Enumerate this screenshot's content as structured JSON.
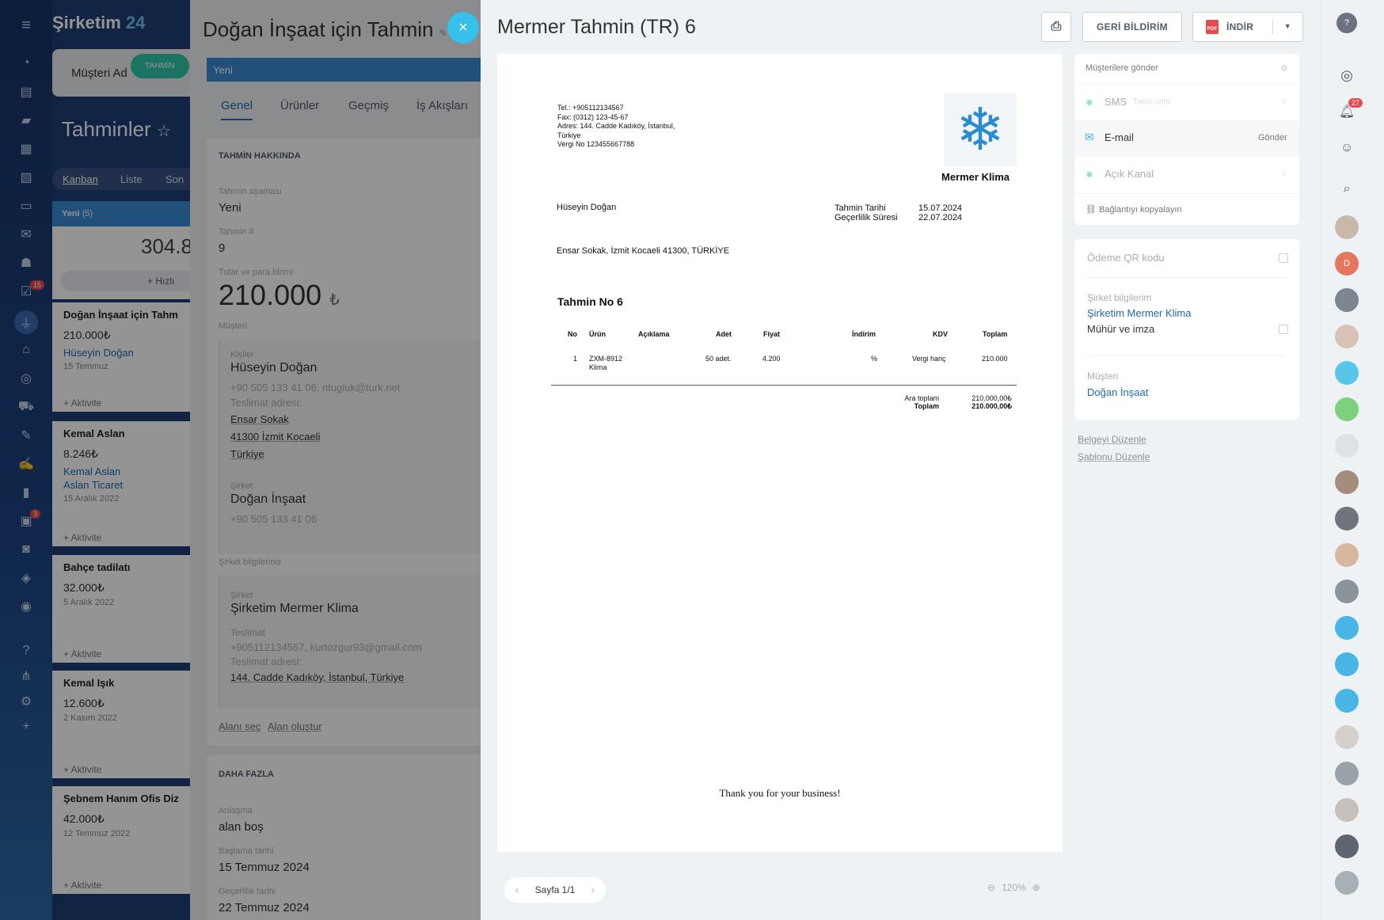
{
  "app": {
    "name": "Şirketim",
    "name_num": "24"
  },
  "rail_badges": {
    "tasks": "15",
    "calendar": "3"
  },
  "crm": {
    "tab_customer": "Müşteri Ad",
    "tab_estimate": "TAHMİN",
    "title": "Tahminler",
    "views": [
      "Kanban",
      "Liste",
      "Son"
    ],
    "column": {
      "label": "Yeni",
      "count": "(5)",
      "total": "304.8",
      "quick": "Hızlı"
    },
    "cards": [
      {
        "title": "Doğan İnşaat için Tahmin",
        "amount": "210.000₺",
        "link1": "Hüseyin Doğan",
        "link2": "",
        "date": "15 Temmuz",
        "action": "+ Aktivite"
      },
      {
        "title": "Kemal Aslan",
        "amount": "8.246₺",
        "link1": "Kemal Aslan",
        "link2": "Aslan Ticaret",
        "date": "15 Aralık 2022",
        "action": "+ Aktivite"
      },
      {
        "title": "Bahçe tadilatı",
        "amount": "32.000₺",
        "link1": "",
        "link2": "",
        "date": "5 Aralık 2022",
        "action": "+ Aktivite"
      },
      {
        "title": "Kemal Işık",
        "amount": "12.600₺",
        "link1": "",
        "link2": "",
        "date": "2 Kasım 2022",
        "action": "+ Aktivite"
      },
      {
        "title": "Şebnem Hanım Ofis Dizayn",
        "amount": "42.000₺",
        "link1": "",
        "link2": "",
        "date": "12 Temmuz 2022",
        "action": "+ Aktivite"
      }
    ]
  },
  "estimate": {
    "title": "Doğan İnşaat için Tahmin",
    "stage_bar": "Yeni",
    "tabs": [
      "Genel",
      "Ürünler",
      "Geçmiş",
      "İş Akışları"
    ],
    "about_header": "TAHMİN HAKKINDA",
    "stage_label": "Tahmin aşaması",
    "stage_value": "Yeni",
    "num_label": "Tahmin #",
    "num_value": "9",
    "amount_label": "Tutar ve para birimi",
    "amount_value": "210.000",
    "currency": "₺",
    "customer_label": "Müşteri",
    "contacts_label": "Kişiler",
    "contact_name": "Hüseyin Doğan",
    "contact_info": "+90 505 133 41 06, ntugluk@turk.net",
    "delivery_label": "Teslimat adresi:",
    "addr1": "Ensar Sokak",
    "addr2": "41300 İzmit Kocaeli",
    "addr3": "Türkiye",
    "company_label": "Şirket",
    "company_name": "Doğan İnşaat",
    "company_phone": "+90 505 133 41 06",
    "yourco_label": "Şirket bilgileriniz",
    "yourco_company_label": "Şirket",
    "yourco_company": "Şirketim Mermer Klima",
    "yourco_delivery_label": "Teslimat",
    "yourco_delivery": "+905112134567, kurtozgur93@gmail.com",
    "yourco_addr_label": "Teslimat adresi:",
    "yourco_addr": "144. Cadde Kadıköy, İstanbul, Türkiye",
    "select_field": "Alanı seç",
    "create_field": "Alan oluştur",
    "more_header": "DAHA FAZLA",
    "deal_label": "Anlaşma",
    "deal_value": "alan boş",
    "start_label": "Başlama tarihi",
    "start_value": "15 Temmuz 2024",
    "valid_label": "Geçerlilik tarihi",
    "valid_value": "22 Temmuz 2024"
  },
  "doc_view": {
    "title": "Mermer Tahmin (TR) 6",
    "feedback": "GERİ BİLDİRİM",
    "download": "İNDİR",
    "page": "Sayfa 1/1",
    "zoom": "120%"
  },
  "document": {
    "tel": "Tel.: +905112134567",
    "fax": "Fax: (0312) 123-45-67",
    "addr": "Adres: 144. Cadde Kadıköy, İstanbul,",
    "country": "Türkiye",
    "tax": "Vergi No 123455667788",
    "company": "Mermer Klima",
    "client": "Hüseyin Doğan",
    "date_label": "Tahmin Tarihi",
    "date_value": "15.07.2024",
    "valid_label": "Geçerlilik Süresi",
    "valid_value": "22.07.2024",
    "client_addr": "Ensar Sokak, İzmit Kocaeli 41300, TÜRKİYE",
    "heading": "Tahmin No 6",
    "cols": [
      "No",
      "Ürün",
      "Açıklama",
      "Adet",
      "Fiyat",
      "İndirim",
      "KDV",
      "Toplam"
    ],
    "row": {
      "no": "1",
      "product": "ZXM-8912",
      "product2": "Klima",
      "qty": "50 adet.",
      "price": "4.200",
      "discount": "%",
      "vat": "Vergi hariç",
      "total": "210.000"
    },
    "subtotal_label": "Ara toplam",
    "subtotal": "210.000,00₺",
    "total_label": "Toplam",
    "total": "210.000,00₺",
    "thanks": "Thank you for your business!"
  },
  "send": {
    "header": "Müşterilere gönder",
    "sms": "SMS",
    "sms_provider": "Twilio.com",
    "email": "E-mail",
    "email_action": "Gönder",
    "open": "Açık Kanal",
    "copy": "Bağlantıyı kopyalayın"
  },
  "options": {
    "qr": "Ödeme QR kodu",
    "my_co_label": "Şirket bilgilerim",
    "my_co": "Şirketim Mermer Klima",
    "stamp": "Mühür ve imza",
    "customer_label": "Müşteri",
    "customer": "Doğan İnşaat",
    "edit_doc": "Belgeyi Düzenle",
    "edit_tpl": "Şablonu Düzenle"
  },
  "rightbar": {
    "notif": "27",
    "avatar_d": "D"
  }
}
